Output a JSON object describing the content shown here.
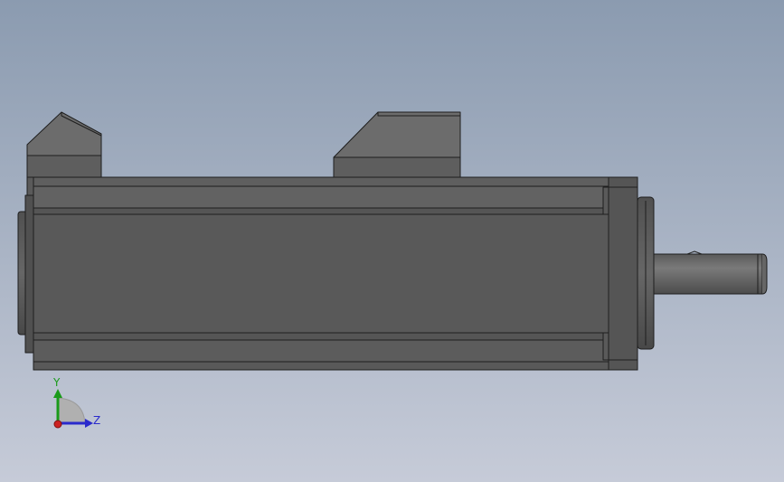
{
  "viewport": {
    "background_top": "#8b9bb0",
    "background_bottom": "#c6cbd8"
  },
  "model": {
    "body_color": "#595959",
    "body_dark": "#4a4a4a",
    "body_light": "#6a6a6a",
    "edge_color": "#1e1e1e"
  },
  "triad": {
    "y_label": "Y",
    "z_label": "Z",
    "y_color": "#1a9a1a",
    "z_color": "#2a2acc",
    "x_color": "#cc2222"
  }
}
